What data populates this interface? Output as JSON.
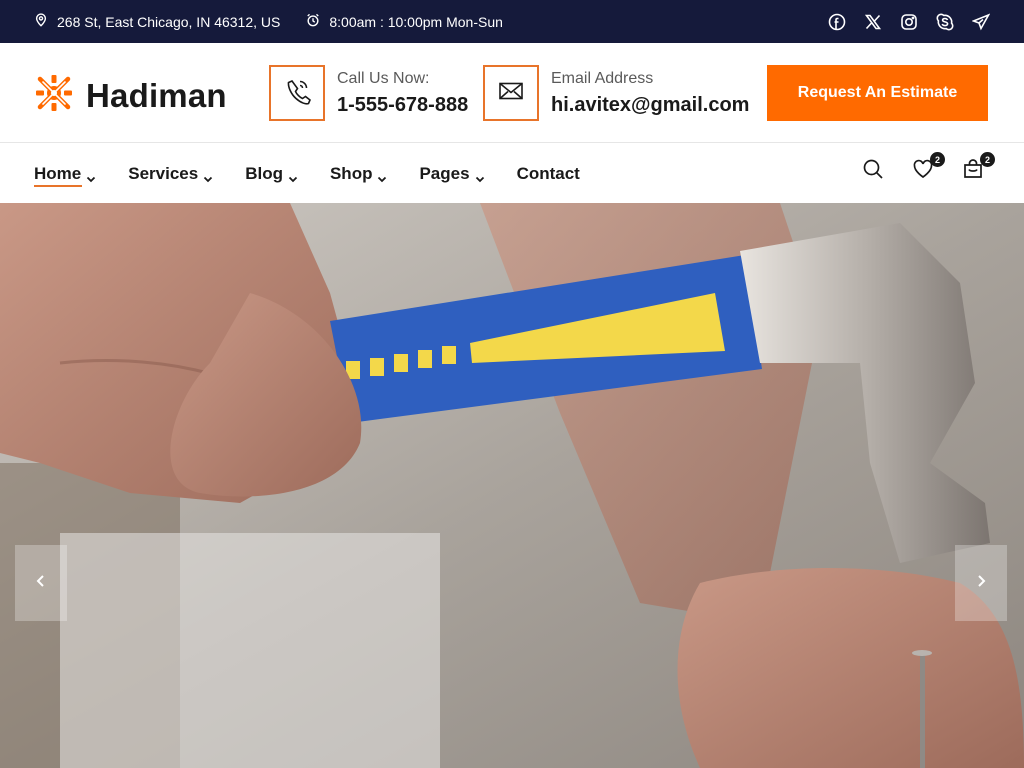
{
  "topbar": {
    "address": "268 St, East Chicago, IN 46312, US",
    "hours": "8:00am : 10:00pm Mon-Sun",
    "social_icons": [
      "facebook-icon",
      "x-icon",
      "instagram-icon",
      "skype-icon",
      "telegram-icon"
    ]
  },
  "header": {
    "logo_text": "Hadiman",
    "phone_label": "Call Us Now:",
    "phone_value": "1-555-678-888",
    "email_label": "Email Address",
    "email_value": "hi.avitex@gmail.com",
    "cta_label": "Request An Estimate"
  },
  "nav": {
    "items": [
      {
        "label": "Home",
        "dropdown": true,
        "active": true
      },
      {
        "label": "Services",
        "dropdown": true
      },
      {
        "label": "Blog",
        "dropdown": true
      },
      {
        "label": "Shop",
        "dropdown": true
      },
      {
        "label": "Pages",
        "dropdown": true
      },
      {
        "label": "Contact",
        "dropdown": false
      }
    ],
    "wishlist_count": "2",
    "cart_count": "2"
  },
  "colors": {
    "accent": "#ff6a00",
    "topbar_bg": "#151a3b",
    "border_accent": "#e8742a"
  }
}
